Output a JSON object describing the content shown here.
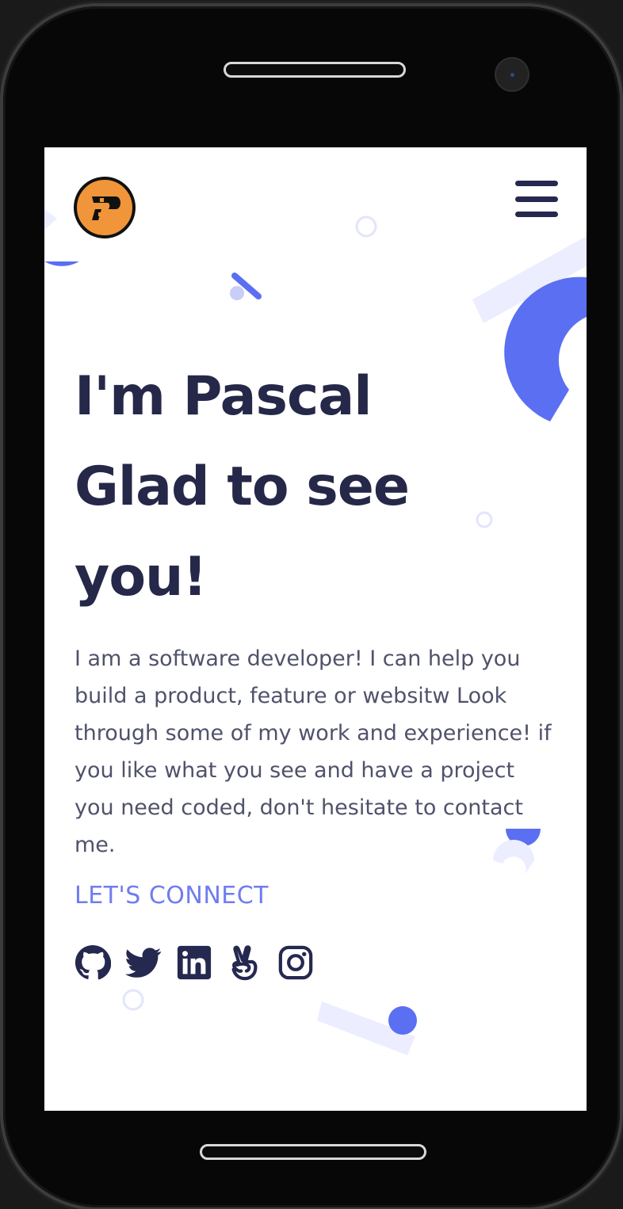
{
  "brand": {
    "logo_letter": "P",
    "logo_color": "#f0953a"
  },
  "header": {
    "menu_icon": "hamburger-menu-icon"
  },
  "hero": {
    "line1": "I'm Pascal",
    "line2": "Glad to see",
    "line3": "you!",
    "intro": "I am a software developer! I can help you build a product, feature or websitw Look through some of my work and experience! if you like what you see and have a project you need coded, don't hesitate to contact me.",
    "connect_label": "LET'S CONNECT"
  },
  "socials": [
    {
      "name": "github",
      "icon": "github-icon"
    },
    {
      "name": "twitter",
      "icon": "twitter-icon"
    },
    {
      "name": "linkedin",
      "icon": "linkedin-icon"
    },
    {
      "name": "angellist",
      "icon": "angellist-icon"
    },
    {
      "name": "instagram",
      "icon": "instagram-icon"
    }
  ],
  "colors": {
    "heading": "#252848",
    "body_text": "#50526b",
    "accent": "#6f7cf0",
    "decor_light": "#eceeff",
    "decor_blue": "#5b6ff2"
  }
}
